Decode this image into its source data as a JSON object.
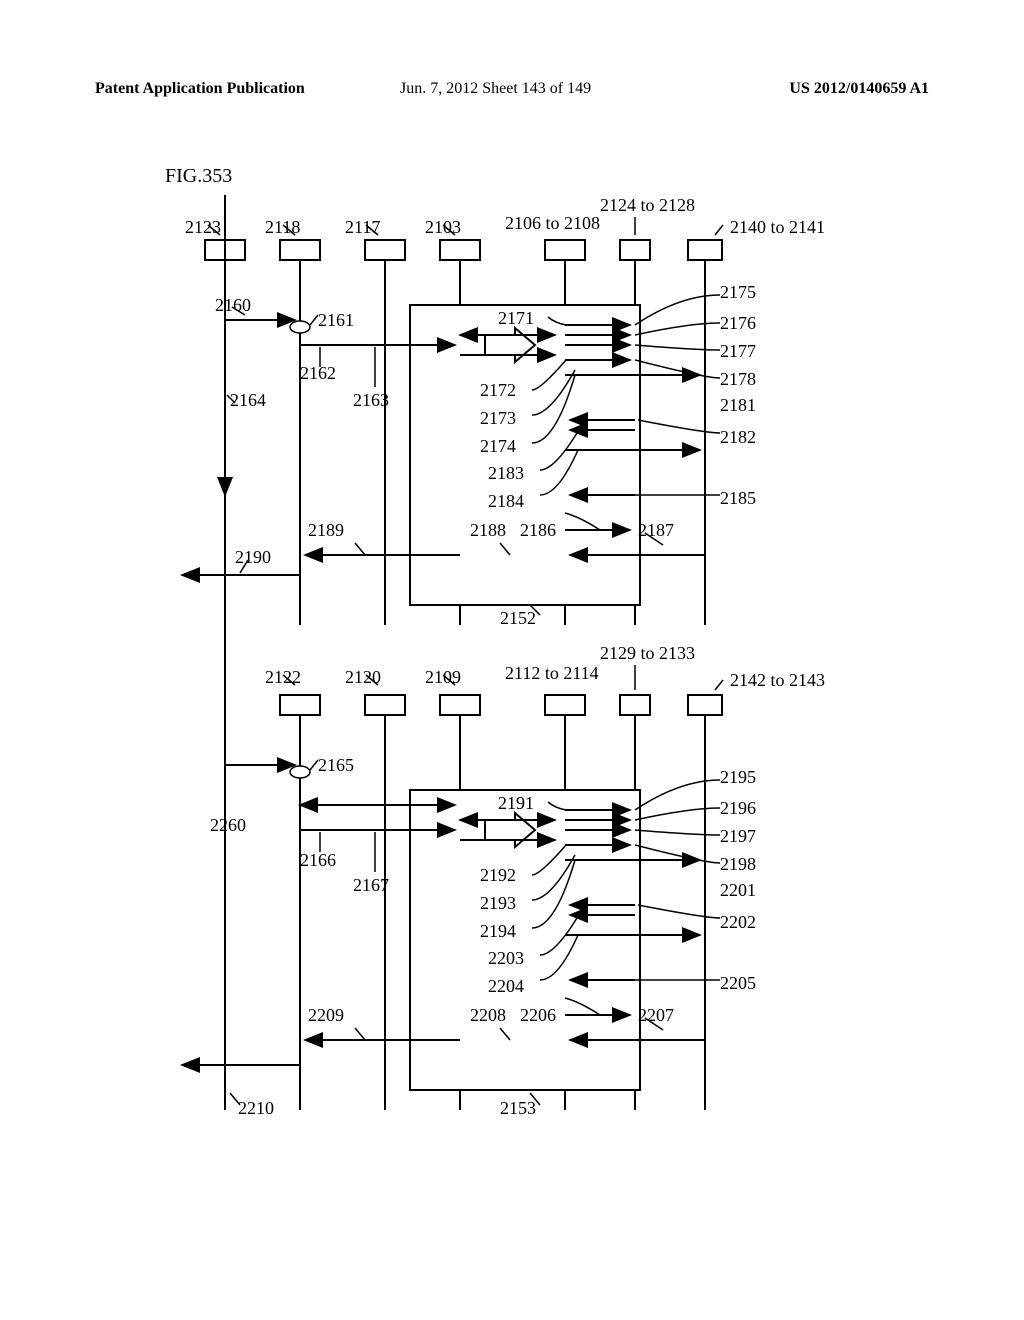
{
  "header": {
    "left": "Patent Application Publication",
    "center": "Jun. 7, 2012  Sheet 143 of 149",
    "right": "US 2012/0140659 A1"
  },
  "figure_label": "FIG.353",
  "labels": {
    "t2123": "2123",
    "t2118": "2118",
    "t2117": "2117",
    "t2103": "2103",
    "t2106_2108": "2106 to 2108",
    "t2124_2128": "2124 to 2128",
    "t2140_2141": "2140 to 2141",
    "t2160": "2160",
    "t2161": "2161",
    "t2162": "2162",
    "t2163": "2163",
    "t2164": "2164",
    "t2171": "2171",
    "t2172": "2172",
    "t2173": "2173",
    "t2174": "2174",
    "t2175": "2175",
    "t2176": "2176",
    "t2177": "2177",
    "t2178": "2178",
    "t2181": "2181",
    "t2182": "2182",
    "t2183": "2183",
    "t2184": "2184",
    "t2185": "2185",
    "t2186": "2186",
    "t2187": "2187",
    "t2188": "2188",
    "t2189": "2189",
    "t2190": "2190",
    "t2152": "2152",
    "t2122": "2122",
    "t2120": "2120",
    "t2109": "2109",
    "t2112_2114": "2112 to 2114",
    "t2129_2133": "2129 to 2133",
    "t2142_2143": "2142 to 2143",
    "t2165": "2165",
    "t2166": "2166",
    "t2167": "2167",
    "t2191": "2191",
    "t2192": "2192",
    "t2193": "2193",
    "t2194": "2194",
    "t2195": "2195",
    "t2196": "2196",
    "t2197": "2197",
    "t2198": "2198",
    "t2201": "2201",
    "t2202": "2202",
    "t2203": "2203",
    "t2204": "2204",
    "t2205": "2205",
    "t2206": "2206",
    "t2207": "2207",
    "t2208": "2208",
    "t2209": "2209",
    "t2210": "2210",
    "t2260": "2260",
    "t2153": "2153"
  }
}
